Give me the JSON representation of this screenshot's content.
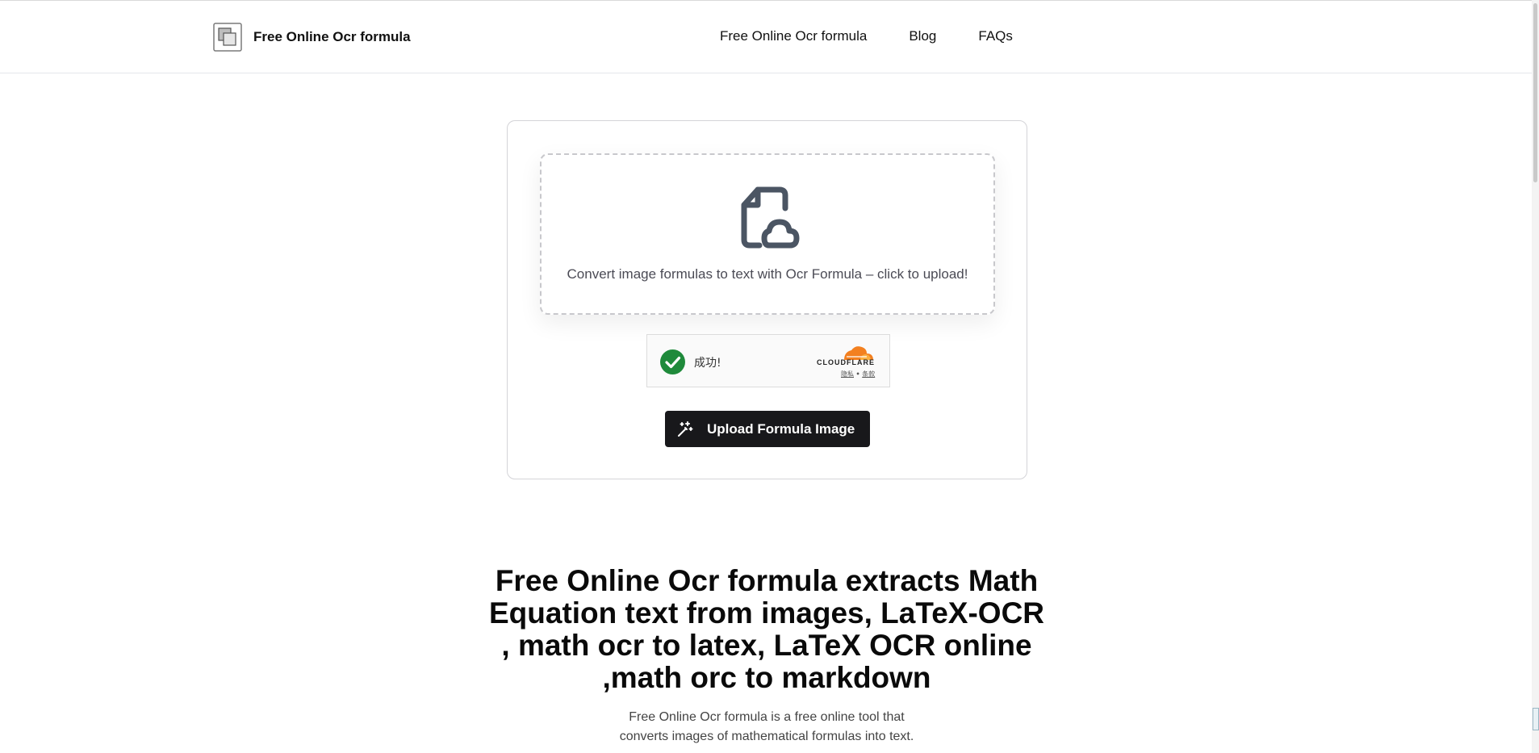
{
  "header": {
    "brand_name": "Free Online Ocr formula",
    "nav_items": [
      "Free Online Ocr formula",
      "Blog",
      "FAQs"
    ]
  },
  "upload_card": {
    "dropzone_text": "Convert image formulas to text with Ocr Formula – click to upload!",
    "upload_icon": "file-cloud-upload-icon",
    "captcha": {
      "status_text": "成功!",
      "provider": "CLOUDFLARE",
      "privacy_link": "隐私",
      "separator": "•",
      "terms_link": "条款"
    },
    "button_label": "Upload Formula Image",
    "button_icon": "magic-wand-icon"
  },
  "hero": {
    "title": "Free Online Ocr formula extracts Math Equation text from images, LaTeX-OCR , math ocr to latex, LaTeX OCR online ,math orc to markdown",
    "description": "Free Online Ocr formula is a free online tool that converts images of mathematical formulas into text."
  },
  "colors": {
    "button_bg": "#18181b",
    "captcha_check": "#1f8a3b",
    "cloudflare_orange": "#f38020",
    "icon_gray": "#4b5563"
  }
}
